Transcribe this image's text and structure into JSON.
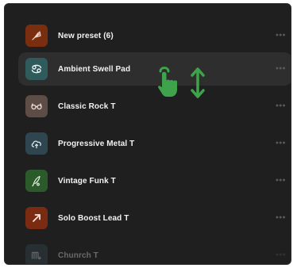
{
  "presets": [
    {
      "label": "New preset (6)",
      "icon": "badminton-shuttlecock-icon",
      "color": "#7a2e10",
      "menu": "•••"
    },
    {
      "label": "Ambient Swell Pad",
      "icon": "cancer-zodiac-icon",
      "color": "#2f5b5c",
      "menu": "•••",
      "selected": true
    },
    {
      "label": "Classic Rock T",
      "icon": "glasses-icon",
      "color": "#5e4d47",
      "menu": "•••"
    },
    {
      "label": "Progressive Metal T",
      "icon": "cloud-upload-icon",
      "color": "#2f4651",
      "menu": "•••"
    },
    {
      "label": "Vintage Funk T",
      "icon": "feather-pen-icon",
      "color": "#2b5a2b",
      "menu": "•••"
    },
    {
      "label": "Solo Boost Lead T",
      "icon": "arrow-up-right-icon",
      "color": "#7b2b11",
      "menu": "•••"
    },
    {
      "label": "Chunrch T",
      "icon": "scorpio-zodiac-icon",
      "color": "#3a4f5a",
      "menu": "•••",
      "faded": true
    }
  ],
  "gesture": {
    "hand_icon": "tap-hand-icon",
    "arrow_icon": "vertical-drag-arrow-icon",
    "accent_color": "#3ea34a"
  }
}
